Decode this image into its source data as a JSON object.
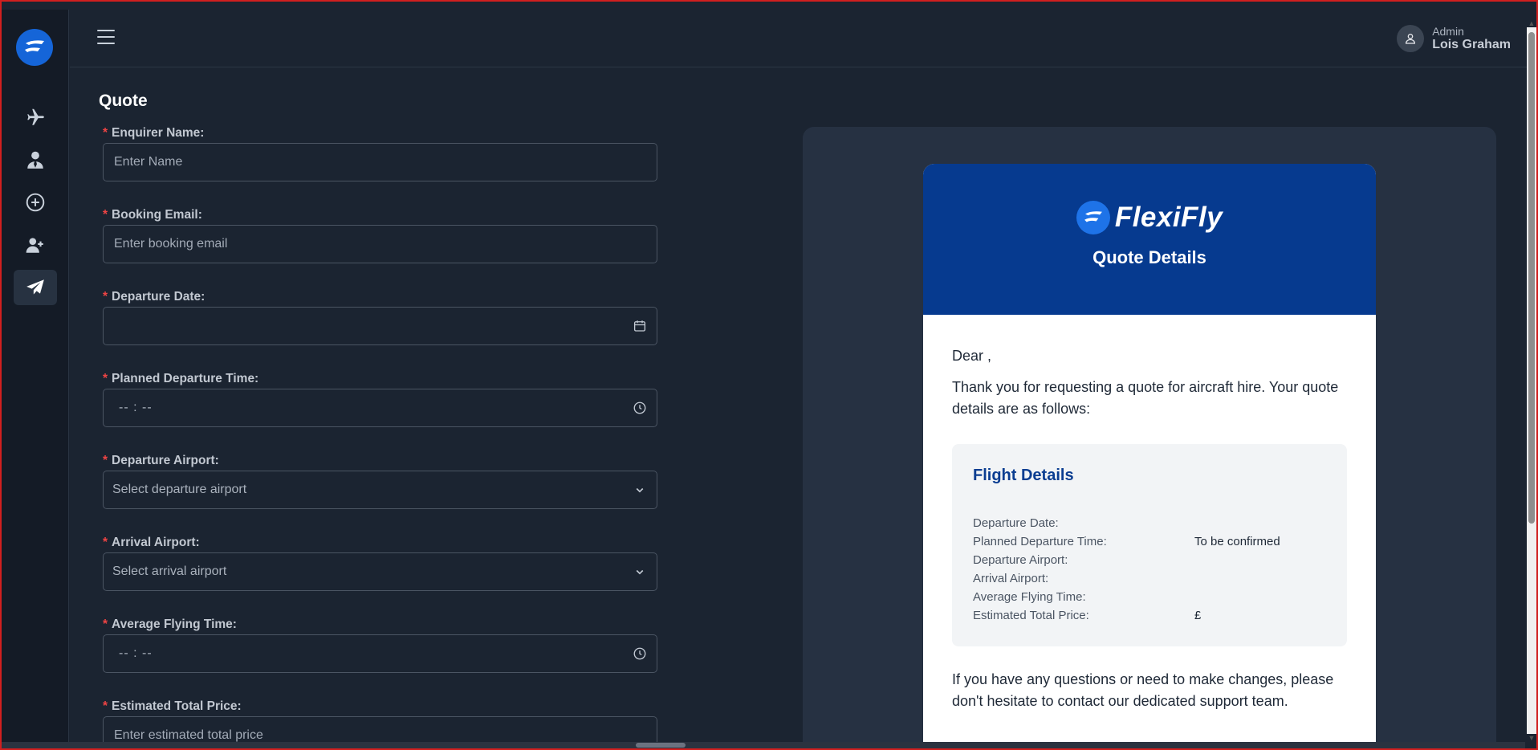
{
  "user": {
    "role": "Admin",
    "name": "Lois Graham"
  },
  "page": {
    "title": "Quote"
  },
  "form": {
    "enquirer_name": {
      "label": "Enquirer Name:",
      "placeholder": "Enter Name"
    },
    "booking_email": {
      "label": "Booking Email:",
      "placeholder": "Enter booking email"
    },
    "departure_date": {
      "label": "Departure Date:",
      "value": ""
    },
    "planned_departure_time": {
      "label": "Planned Departure Time:",
      "value": "-- : --"
    },
    "departure_airport": {
      "label": "Departure Airport:",
      "placeholder": "Select departure airport"
    },
    "arrival_airport": {
      "label": "Arrival Airport:",
      "placeholder": "Select arrival airport"
    },
    "average_flying_time": {
      "label": "Average Flying Time:",
      "value": "-- : --"
    },
    "estimated_total_price": {
      "label": "Estimated Total Price:",
      "placeholder": "Enter estimated total price"
    },
    "required_marker": "*"
  },
  "preview": {
    "brand": "FlexiFly",
    "title": "Quote Details",
    "greeting": "Dear ,",
    "intro": "Thank you for requesting a quote for aircraft hire. Your quote details are as follows:",
    "details_title": "Flight Details",
    "rows": [
      {
        "k": "Departure Date:",
        "v": ""
      },
      {
        "k": "Planned Departure Time:",
        "v": "To be confirmed"
      },
      {
        "k": "Departure Airport:",
        "v": ""
      },
      {
        "k": "Arrival Airport:",
        "v": ""
      },
      {
        "k": "Average Flying Time:",
        "v": ""
      },
      {
        "k": "Estimated Total Price:",
        "v": "£"
      }
    ],
    "closing": "If you have any questions or need to make changes, please don't hesitate to contact our dedicated support team."
  },
  "icons": {
    "sidebar": [
      "plane-icon",
      "user-tie-icon",
      "plus-circle-icon",
      "user-plus-icon",
      "paper-plane-icon"
    ]
  },
  "colors": {
    "accent": "#063a8f",
    "brand_blue": "#1565d8",
    "required": "#ef4444"
  }
}
